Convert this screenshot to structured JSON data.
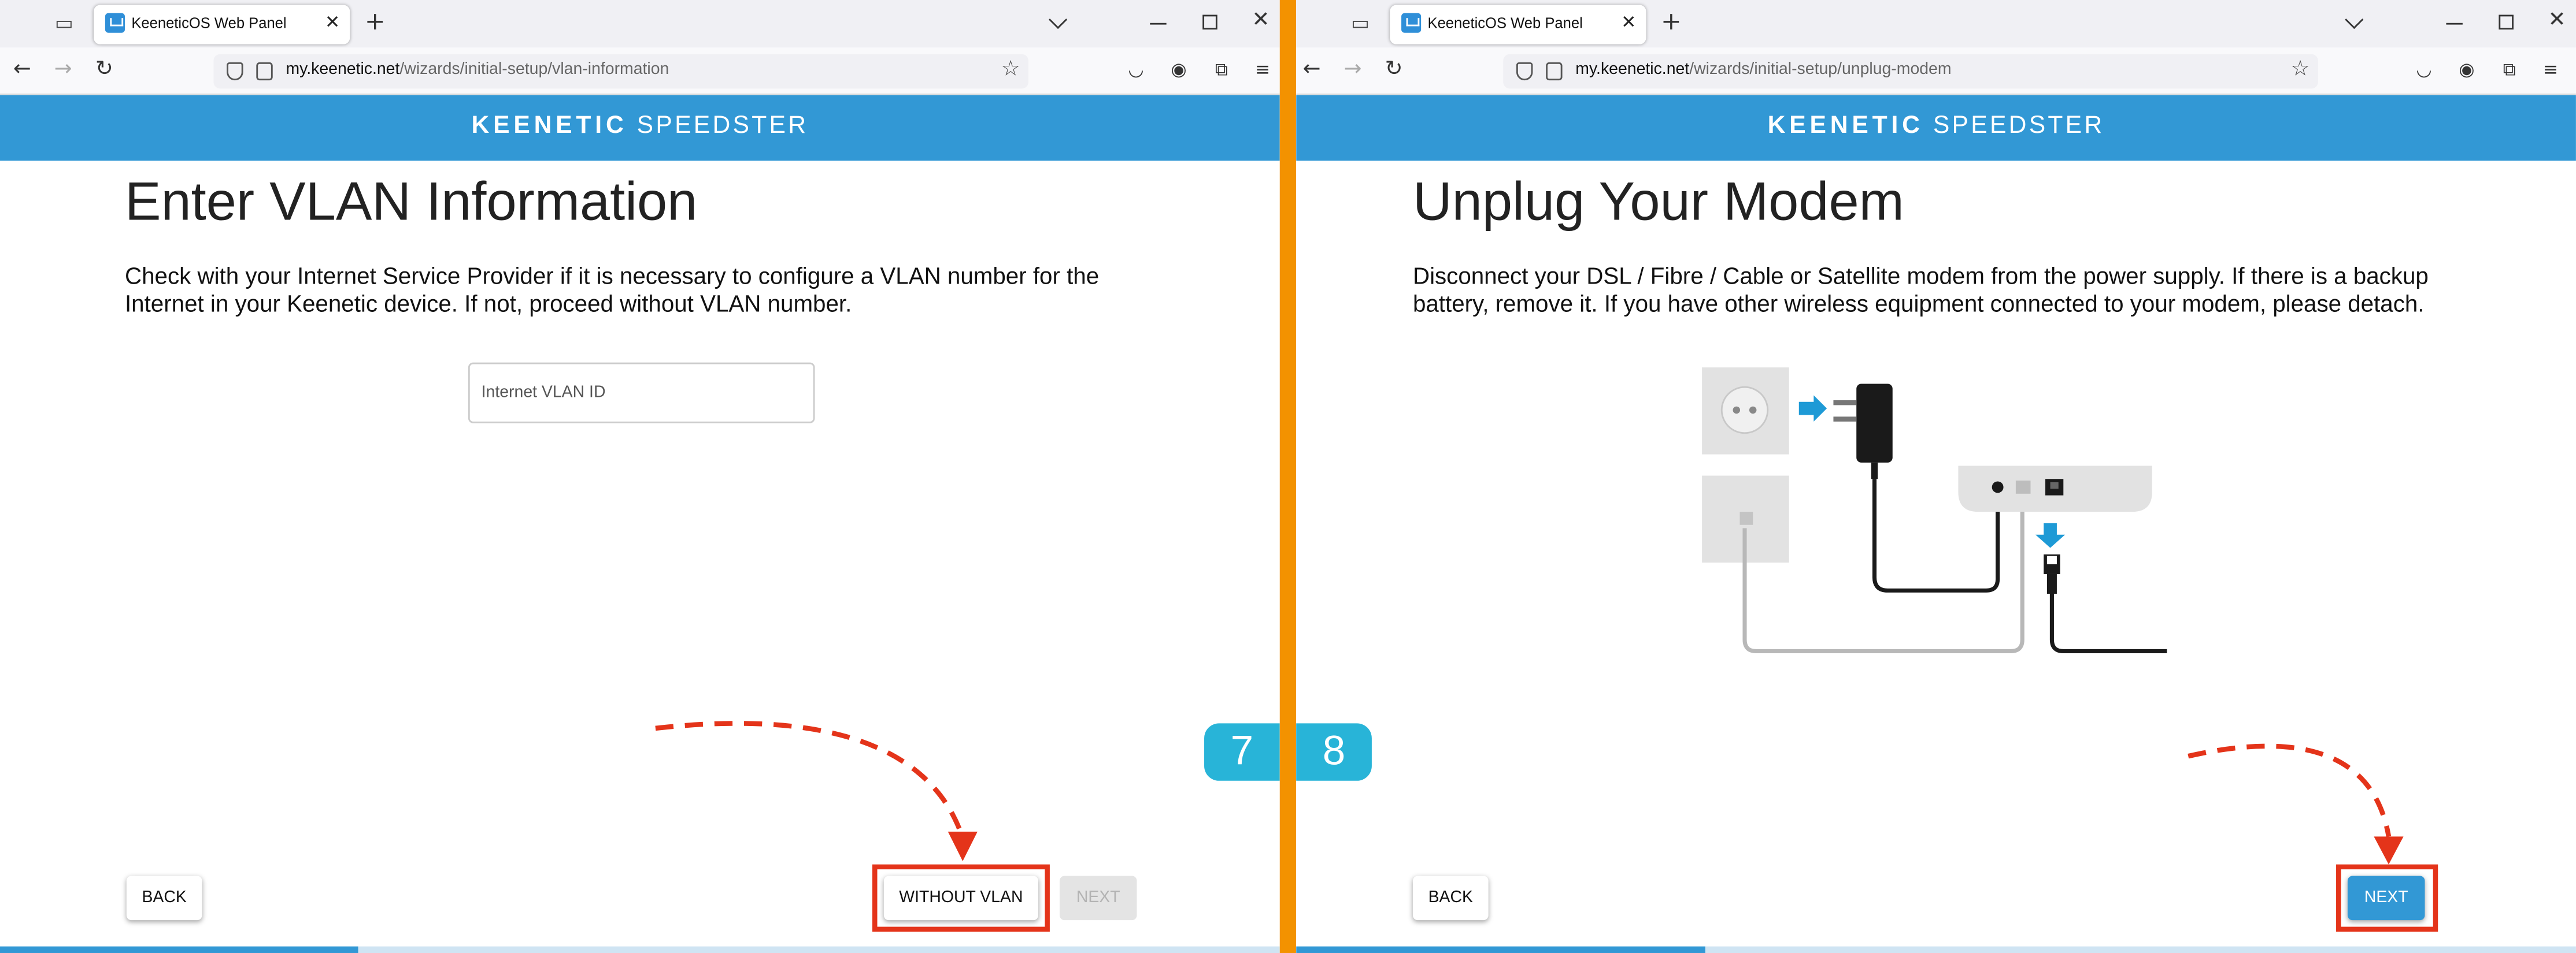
{
  "colors": {
    "accent": "#3298d5",
    "divider": "#f39200",
    "annotation": "#e4341a",
    "step_badge": "#28b4d8"
  },
  "left": {
    "browser": {
      "tab_title": "KeeneticOS Web Panel",
      "url_host": "my.keenetic.net",
      "url_path": "/wizards/initial-setup/vlan-information"
    },
    "brand": {
      "bold": "KEENETIC",
      "light": "SPEEDSTER"
    },
    "title": "Enter VLAN Information",
    "description": "Check with your Internet Service Provider if it is necessary to configure a VLAN number for the Internet in your Keenetic device. If not, proceed without VLAN number.",
    "vlan_input": {
      "placeholder": "Internet VLAN ID",
      "value": ""
    },
    "buttons": {
      "back": "BACK",
      "without_vlan": "WITHOUT VLAN",
      "next": "NEXT"
    },
    "step": "7",
    "progress": 0.28
  },
  "right": {
    "browser": {
      "tab_title": "KeeneticOS Web Panel",
      "url_host": "my.keenetic.net",
      "url_path": "/wizards/initial-setup/unplug-modem"
    },
    "brand": {
      "bold": "KEENETIC",
      "light": "SPEEDSTER"
    },
    "title": "Unplug Your Modem",
    "description": "Disconnect your DSL / Fibre / Cable or Satellite modem from the power supply. If there is a backup battery, remove it. If you have other wireless equipment connected to your modem, please detach.",
    "buttons": {
      "back": "BACK",
      "next": "NEXT"
    },
    "step": "8",
    "progress": 0.32
  },
  "icons": [
    "tab-list-icon",
    "favicon-icon",
    "close-icon",
    "plus-icon",
    "chevron-down-icon",
    "minimize-icon",
    "maximize-icon",
    "back-arrow-icon",
    "forward-arrow-icon",
    "reload-icon",
    "shield-icon",
    "lock-icon",
    "star-icon",
    "pocket-icon",
    "account-icon",
    "extensions-icon",
    "menu-icon"
  ]
}
